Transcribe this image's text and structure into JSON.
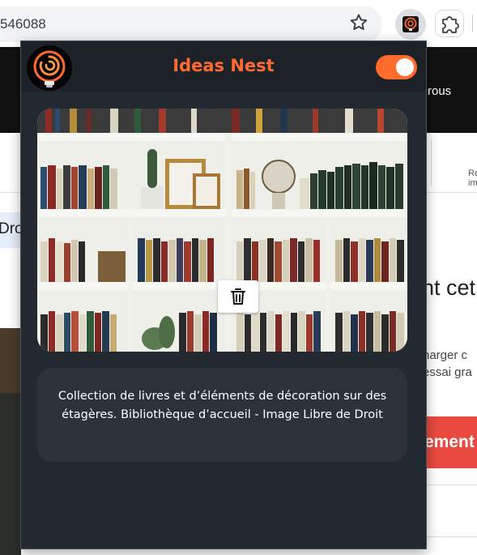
{
  "browser": {
    "url_partial": "546088",
    "icons": {
      "bookmark": "star-icon",
      "extension": "ideas-nest-extension-icon",
      "extensions_menu": "puzzle-icon"
    }
  },
  "background_page": {
    "header_text": "rous",
    "nav_text": "Re im",
    "left_tab_text": "Dro",
    "heading": "nt cet",
    "paragraph": [
      "harger c",
      "essai gra"
    ],
    "cta_label": "ement"
  },
  "popup": {
    "title": "Ideas Nest",
    "toggle_enabled": true,
    "image_alt": "Bookshelf with books and decorations",
    "delete_icon": "trash-icon",
    "caption": "Collection de livres et d’éléments de décoration sur des étagères. Bibliothèque d’accueil - Image Libre de Droit"
  },
  "colors": {
    "accent": "#ff6a2d",
    "popup_bg": "#232931",
    "header_bg": "#1d2228",
    "caption_bg": "#2c323a",
    "cta_red": "#e84a3f"
  }
}
